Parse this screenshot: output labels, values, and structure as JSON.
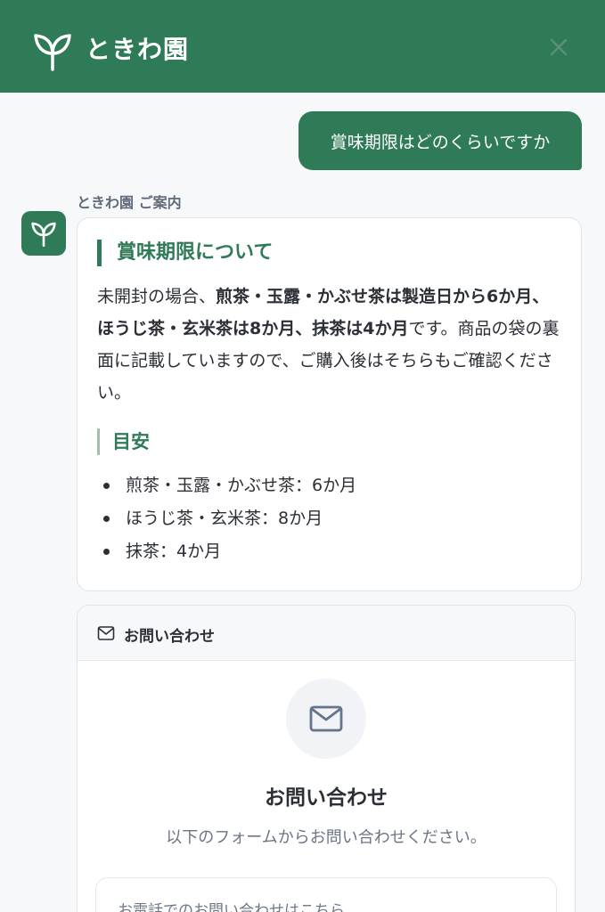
{
  "header": {
    "brand": "ときわ園"
  },
  "chat": {
    "user_message": "賞味期限はどのくらいですか",
    "bot_label": "ときわ園 ご案内",
    "answer": {
      "heading": "賞味期限について",
      "para_1": "未開封の場合、",
      "para_bold_1": "煎茶・玉露・かぶせ茶は製造日から6か月、ほうじ茶・玄米茶は8か月、抹茶は4か月",
      "para_2": "です。商品の袋の裏面に記載していますので、ご購入後はそちらもご確認ください。",
      "sub_heading": "目安",
      "items": [
        "煎茶・玉露・かぶせ茶：6か月",
        "ほうじ茶・玄米茶：8か月",
        "抹茶：4か月"
      ]
    }
  },
  "contact": {
    "header_title": "お問い合わせ",
    "title": "お問い合わせ",
    "description": "以下のフォームからお問い合わせください。",
    "phone_label": "お電話でのお問い合わせはこちら"
  },
  "colors": {
    "brand_green": "#2f7a57",
    "accent_light": "#9fbfae"
  }
}
